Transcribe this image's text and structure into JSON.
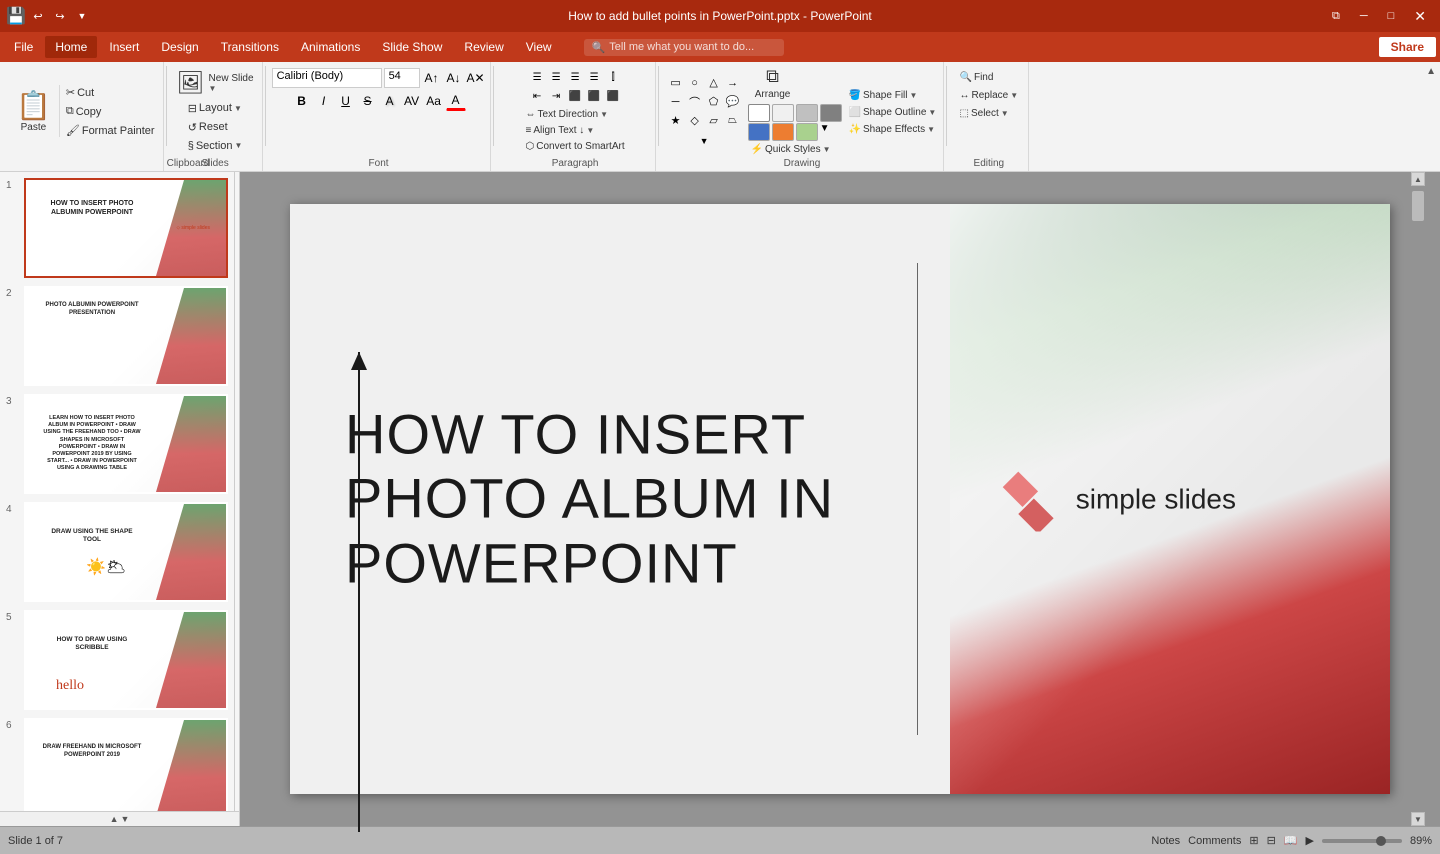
{
  "titleBar": {
    "title": "How to add bullet points in PowerPoint.pptx - PowerPoint",
    "quickAccessIcons": [
      "save",
      "undo",
      "redo",
      "customize"
    ],
    "windowControls": [
      "restore",
      "minimize",
      "maximize",
      "close"
    ]
  },
  "menuBar": {
    "items": [
      "File",
      "Home",
      "Insert",
      "Design",
      "Transitions",
      "Animations",
      "Slide Show",
      "Review",
      "View"
    ],
    "activeItem": "Home",
    "searchPlaceholder": "Tell me what you want to do...",
    "shareLabel": "Share"
  },
  "ribbon": {
    "groups": {
      "clipboard": {
        "label": "Clipboard",
        "paste": "Paste",
        "copy": "Copy",
        "cut": "Cut",
        "formatPainter": "Format Painter"
      },
      "slides": {
        "label": "Slides",
        "newSlide": "New Slide",
        "layout": "Layout",
        "reset": "Reset",
        "section": "Section"
      },
      "font": {
        "label": "Font",
        "fontName": "Calibri (Body)",
        "fontSize": "54",
        "bold": "B",
        "italic": "I",
        "underline": "U",
        "strikethrough": "S",
        "shadow": "A",
        "charSpacing": "AV",
        "caseChange": "Aa",
        "fontColor": "A",
        "increaseFontSize": "A↑",
        "decreaseFontSize": "A↓",
        "clearFormatting": "A✕"
      },
      "paragraph": {
        "label": "Paragraph",
        "textDirection": "Text Direction",
        "alignText": "Align Text ↓",
        "convertToSmartArt": "Convert to SmartArt",
        "bullets": [
          "☰",
          "☰",
          "☰"
        ],
        "numbering": [
          "1.",
          "2.",
          "3."
        ],
        "indent": [
          "←",
          "→"
        ],
        "align": [
          "⬜",
          "⬜",
          "⬜",
          "⬜"
        ],
        "lineSpacing": "↕",
        "columns": "⫿"
      },
      "drawing": {
        "label": "Drawing",
        "shapes": [
          "rect",
          "oval",
          "triangle",
          "arrow",
          "line",
          "connector",
          "star",
          "callout"
        ],
        "arrange": "Arrange",
        "quickStyles": "Quick Styles",
        "shapeFill": "Shape Fill",
        "shapeOutline": "Shape Outline",
        "shapeEffects": "Shape Effects"
      },
      "editing": {
        "label": "Editing",
        "find": "Find",
        "replace": "Replace",
        "select": "Select"
      }
    }
  },
  "slides": [
    {
      "num": "1",
      "active": true,
      "title": "HOW TO INSERT\nPHOTO ALBUMIN\nPOWERPOINT",
      "subtitle": "simple slides"
    },
    {
      "num": "2",
      "title": "PHOTO ALBUMIN\nPOWERPOINT PRESENTATION",
      "subtitle": ""
    },
    {
      "num": "3",
      "title": "LEARN HOW TO INSERT PHOTO\nALBUM IN POWERPOINT\n• Draw using the freehand too\n• Draw shapes in Microsoft PowerPoint\n• Draw in PowerPoint 2019 by using start...\n• Draw in PowerPoint using a\n  drawing table",
      "subtitle": ""
    },
    {
      "num": "4",
      "title": "DRAW USING THE SHAPE\nTOOL",
      "subtitle": ""
    },
    {
      "num": "5",
      "title": "HOW TO DRAW USING\nSCRIBBLE",
      "subtitle": "hello"
    },
    {
      "num": "6",
      "title": "DRAW FREEHAND IN MICROSOFT\nPOWERPOINT 2019",
      "subtitle": ""
    }
  ],
  "mainSlide": {
    "title": "HOW TO INSERT\nPHOTO ALBUM IN\nPOWERPOINT",
    "logoText": "simple slides"
  },
  "statusBar": {
    "slideInfo": "Slide 1 of 7",
    "language": "",
    "notes": "Notes",
    "comments": "Comments",
    "zoom": "89%"
  }
}
